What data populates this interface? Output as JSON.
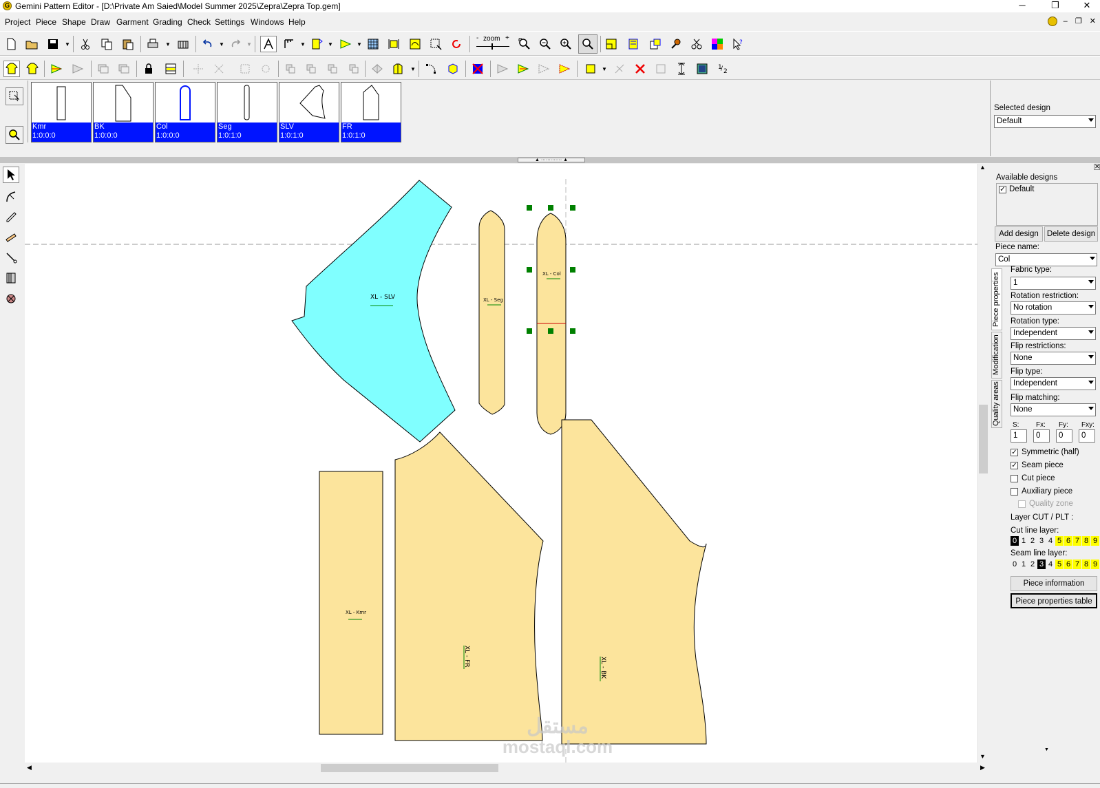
{
  "window": {
    "title": "Gemini Pattern Editor - [D:\\Private Am Saied\\Model Summer 2025\\Zepra\\Zepra Top.gem]",
    "app_icon": "G",
    "minimize": "─",
    "maximize": "❐",
    "close": "✕"
  },
  "menu": [
    "Project",
    "Piece",
    "Shape",
    "Draw",
    "Garment",
    "Grading",
    "Check",
    "Settings",
    "Windows",
    "Help"
  ],
  "mdi_controls": [
    "–",
    "❐",
    "✕"
  ],
  "toolbar1": {
    "zoom_label": "zoom",
    "zoom_minus": "-",
    "zoom_plus": "+"
  },
  "pieces": [
    {
      "name": "Kmr",
      "ratio": "1:0:0:0"
    },
    {
      "name": "BK",
      "ratio": "1:0:0:0"
    },
    {
      "name": "Col",
      "ratio": "1:0:0:0"
    },
    {
      "name": "Seg",
      "ratio": "1:0:1:0"
    },
    {
      "name": "SLV",
      "ratio": "1:0:1:0"
    },
    {
      "name": "FR",
      "ratio": "1:0:1:0"
    }
  ],
  "selected_design": {
    "label": "Selected design",
    "value": "Default"
  },
  "canvas_labels": {
    "slv": "XL - SLV",
    "seg": "XL - Seg",
    "col": "XL - Col",
    "kmr": "XL - Kmr",
    "fr": "XL - FR",
    "bk": "XL - BK"
  },
  "colors": {
    "piece_fill": "#fce49c",
    "selected_fill": "#80ffff",
    "handle": "#008000",
    "thumb_label_bg": "#0014ff"
  },
  "panel": {
    "available_designs_label": "Available designs",
    "designs": [
      {
        "name": "Default",
        "checked": true
      }
    ],
    "add_design": "Add design",
    "delete_design": "Delete design",
    "piece_name_label": "Piece name:",
    "piece_name": "Col",
    "tabs": [
      "Piece properties",
      "Modification",
      "Quality areas"
    ],
    "fabric_type_label": "Fabric type:",
    "fabric_type": "1",
    "rotation_restriction_label": "Rotation restriction:",
    "rotation_restriction": "No rotation",
    "rotation_type_label": "Rotation type:",
    "rotation_type": "Independent",
    "flip_restrictions_label": "Flip restrictions:",
    "flip_restrictions": "None",
    "flip_type_label": "Flip type:",
    "flip_type": "Independent",
    "flip_matching_label": "Flip matching:",
    "flip_matching": "None",
    "s_label": "S:",
    "s_value": "1",
    "fx_label": "Fx:",
    "fx_value": "0",
    "fy_label": "Fy:",
    "fy_value": "0",
    "fxy_label": "Fxy:",
    "fxy_value": "0",
    "symmetric_label": "Symmetric (half)",
    "seam_piece_label": "Seam piece",
    "cut_piece_label": "Cut piece",
    "auxiliary_label": "Auxiliary piece",
    "quality_zone_label": "Quality zone",
    "layer_title": "Layer CUT / PLT :",
    "cut_line_label": "Cut line layer:",
    "seam_line_label": "Seam line layer:",
    "layers": [
      "0",
      "1",
      "2",
      "3",
      "4",
      "5",
      "6",
      "7",
      "8",
      "9"
    ],
    "cut_selected": "0",
    "seam_selected": "3",
    "piece_information": "Piece information",
    "piece_properties_table": "Piece properties table"
  },
  "watermark": {
    "arabic": "مستقل",
    "latin": "mostaql.com"
  }
}
